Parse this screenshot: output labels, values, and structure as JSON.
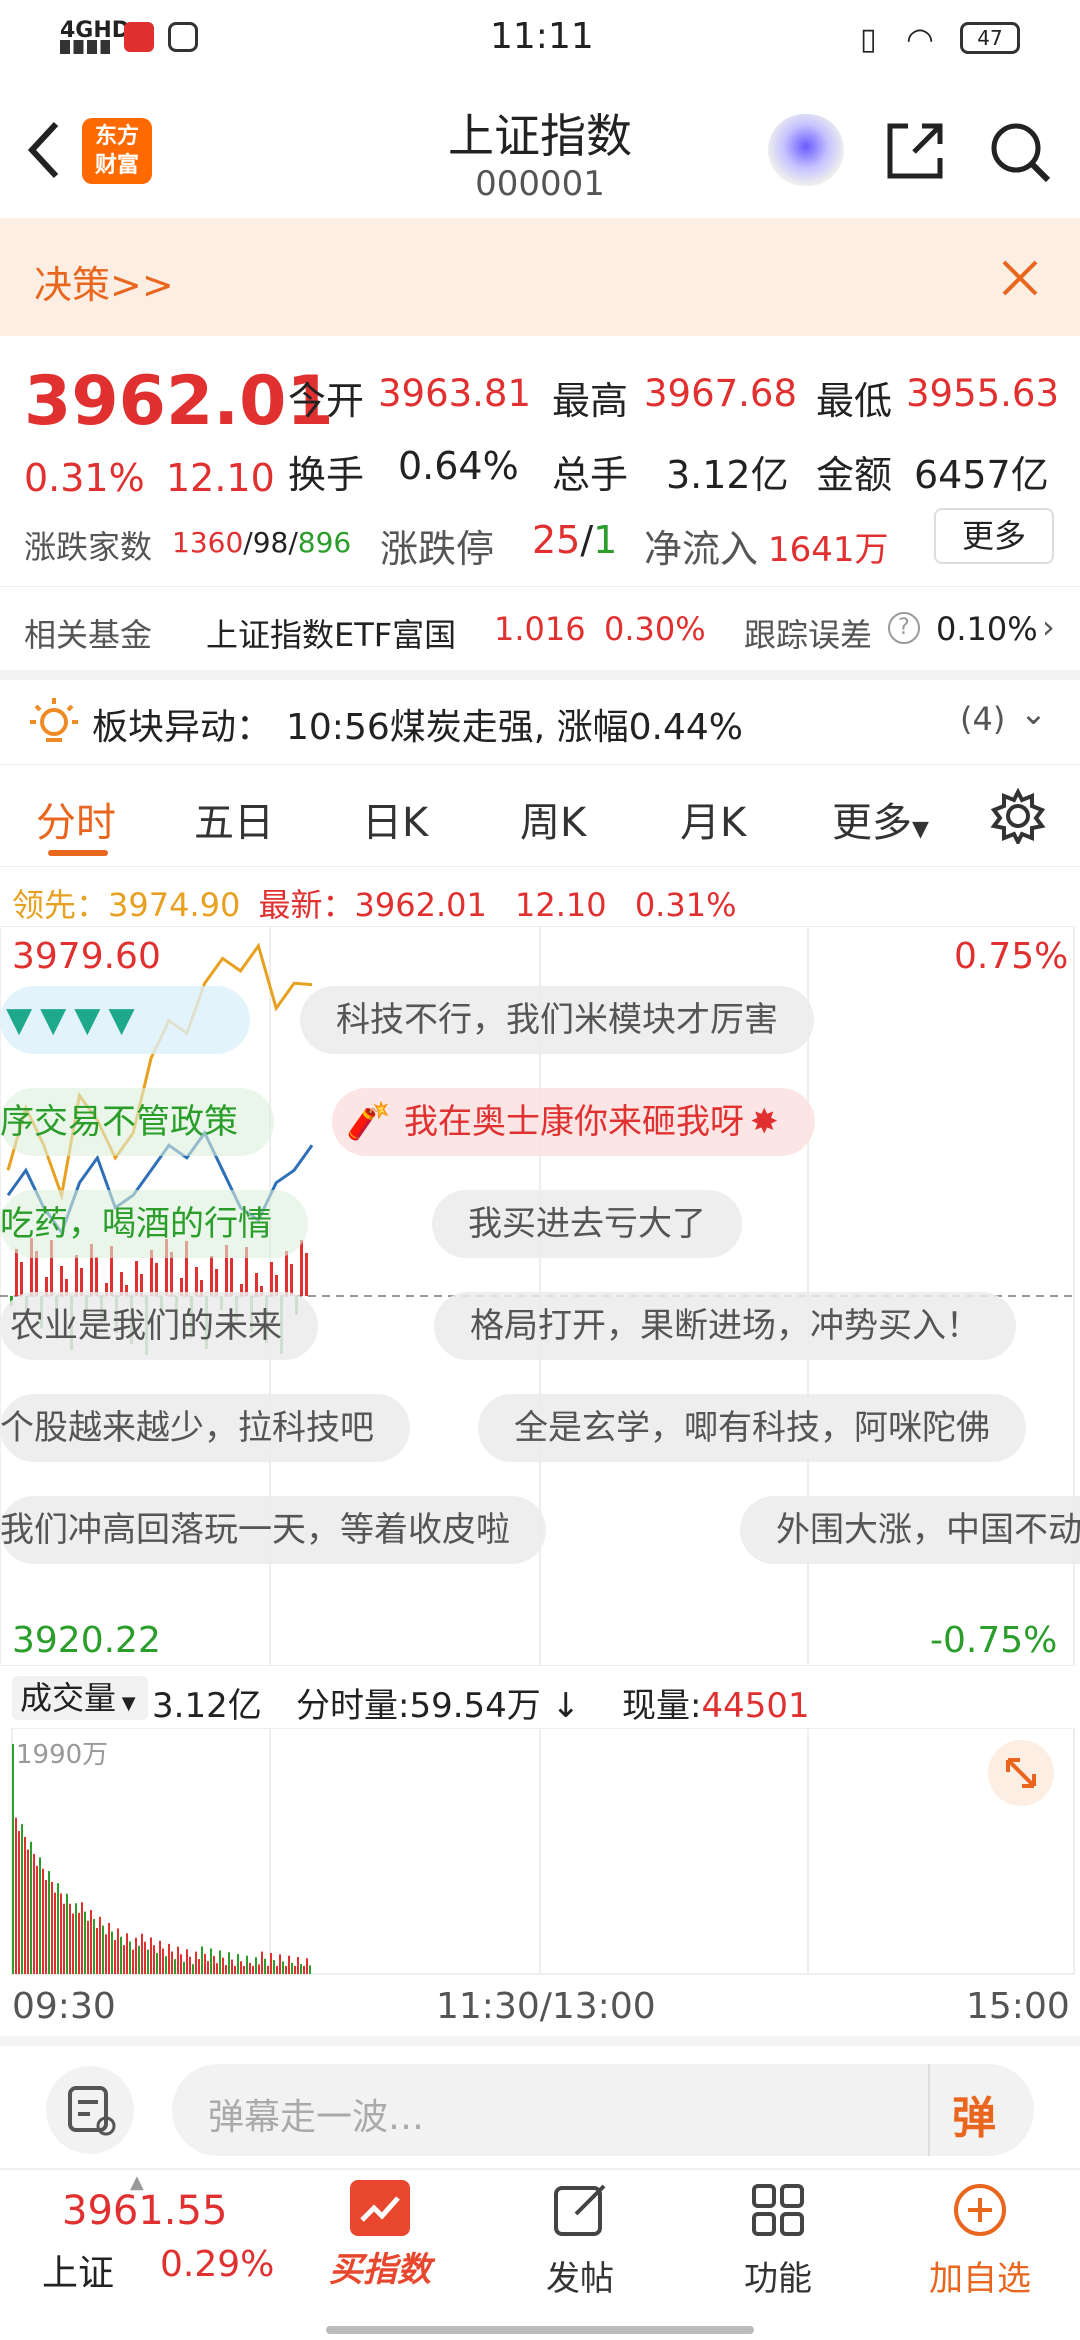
{
  "status": {
    "time": "11:11",
    "signal": "4GHD",
    "battery": "47"
  },
  "header": {
    "logo_line1": "东方",
    "logo_line2": "财富",
    "title": "上证指数",
    "code": "000001"
  },
  "banner": {
    "text": "决策>>"
  },
  "quote": {
    "price": "3962.01",
    "pct": "0.31%",
    "change": "12.10",
    "open_label": "今开",
    "open": "3963.81",
    "high_label": "最高",
    "high": "3967.68",
    "low_label": "最低",
    "low": "3955.63",
    "turnover_label": "换手",
    "turnover": "0.64%",
    "volume_label": "总手",
    "volume": "3.12亿",
    "amount_label": "金额",
    "amount": "6457亿",
    "breadth_label": "涨跌家数",
    "up": "1360",
    "flat": "98",
    "down": "896",
    "limit_label": "涨跌停",
    "limit_up": "25",
    "limit_down": "1",
    "inflow_label": "净流入",
    "inflow": "1641万",
    "more_button": "更多"
  },
  "fund": {
    "label": "相关基金",
    "name": "上证指数ETF富国",
    "price": "1.016",
    "pct": "0.30%",
    "err_label": "跟踪误差",
    "err": "0.10%"
  },
  "sector": {
    "label": "板块异动：",
    "text": "10:56煤炭走强, 涨幅0.44%",
    "count": "(4)"
  },
  "tabs": [
    "分时",
    "五日",
    "日K",
    "周K",
    "月K",
    "更多"
  ],
  "chart_header": {
    "lead_label": "领先：",
    "lead": "3974.90",
    "latest_label": "最新：",
    "latest": "3962.01",
    "change": "12.10",
    "pct": "0.31%"
  },
  "chart_axis": {
    "top_price": "3979.60",
    "top_pct": "0.75%",
    "bottom_price": "3920.22",
    "bottom_pct": "-0.75%"
  },
  "danmaku": [
    "科技不行，我们米模块才厉害",
    "序交易不管政策",
    "我在奥士康你来砸我呀",
    "吃药，喝酒的行情",
    "我买进去亏大了",
    "农业是我们的未来",
    "格局打开，果断进场，冲势买入！",
    "个股越来越少，拉科技吧",
    "全是玄学，唧有科技，阿咪陀佛",
    "我们冲高回落玩一天，等着收皮啦",
    "外围大涨，中国不动"
  ],
  "volume_bar": {
    "label": "成交量",
    "total": "3.12亿",
    "minute_label": "分时量:",
    "minute": "59.54万",
    "now_label": "现量:",
    "now": "44501",
    "max": "1990万"
  },
  "time_axis": {
    "start": "09:30",
    "mid": "11:30/13:00",
    "end": "15:00"
  },
  "input": {
    "placeholder": "弹幕走一波…",
    "send": "弹"
  },
  "bottomnav": {
    "index_price": "3961.55",
    "index_name": "上证",
    "index_pct": "0.29%",
    "buy": "买指数",
    "post": "发帖",
    "func": "功能",
    "add": "加自选"
  },
  "chart_data": {
    "type": "line",
    "series": [
      {
        "values": [
          3960,
          3965,
          3962,
          3958,
          3966,
          3964,
          3961,
          3963,
          3969,
          3972,
          3971,
          3975,
          3977,
          3976,
          3978,
          3973,
          3975,
          3974.9
        ]
      },
      {
        "values": [
          3958,
          3960,
          3957,
          3955,
          3959,
          3961,
          3957,
          3958,
          3960,
          3962,
          3961,
          3963,
          3960,
          3957,
          3956,
          3959,
          3960,
          3962.01
        ]
      }
    ],
    "ylim": [
      3920.22,
      3979.6
    ]
  },
  "colors": {
    "up": "#e03030",
    "down": "#2a9d2a",
    "accent": "#ff6a00",
    "lead_line": "#e8a020",
    "price_line": "#2f6fb5"
  }
}
